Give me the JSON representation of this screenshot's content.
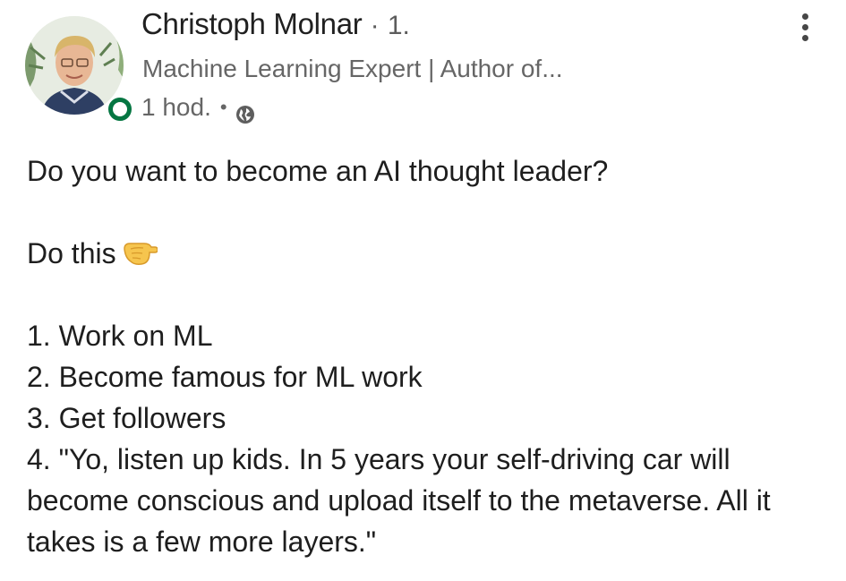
{
  "post": {
    "author": {
      "name": "Christoph Molnar",
      "separator": "·",
      "degree": "1.",
      "headline": "Machine Learning Expert | Author of...",
      "online": true
    },
    "meta": {
      "time": "1 hod.",
      "separator": "•",
      "visibility_icon": "globe-icon"
    },
    "menu_icon": "more-vertical-icon",
    "body": {
      "question": "Do you want to become an AI thought leader?",
      "intro": "Do this",
      "intro_icon": "backhand-index-pointing-right-icon",
      "steps": [
        "1. Work on ML",
        "2. Become famous for ML work",
        "3. Get followers",
        "4. \"Yo, listen up kids. In 5 years your self-driving car will become conscious and upload itself to the metaverse. All it takes is a few more layers.\""
      ]
    },
    "colors": {
      "online": "#057642",
      "text": "#1e1e1e",
      "secondary": "#666666"
    }
  }
}
